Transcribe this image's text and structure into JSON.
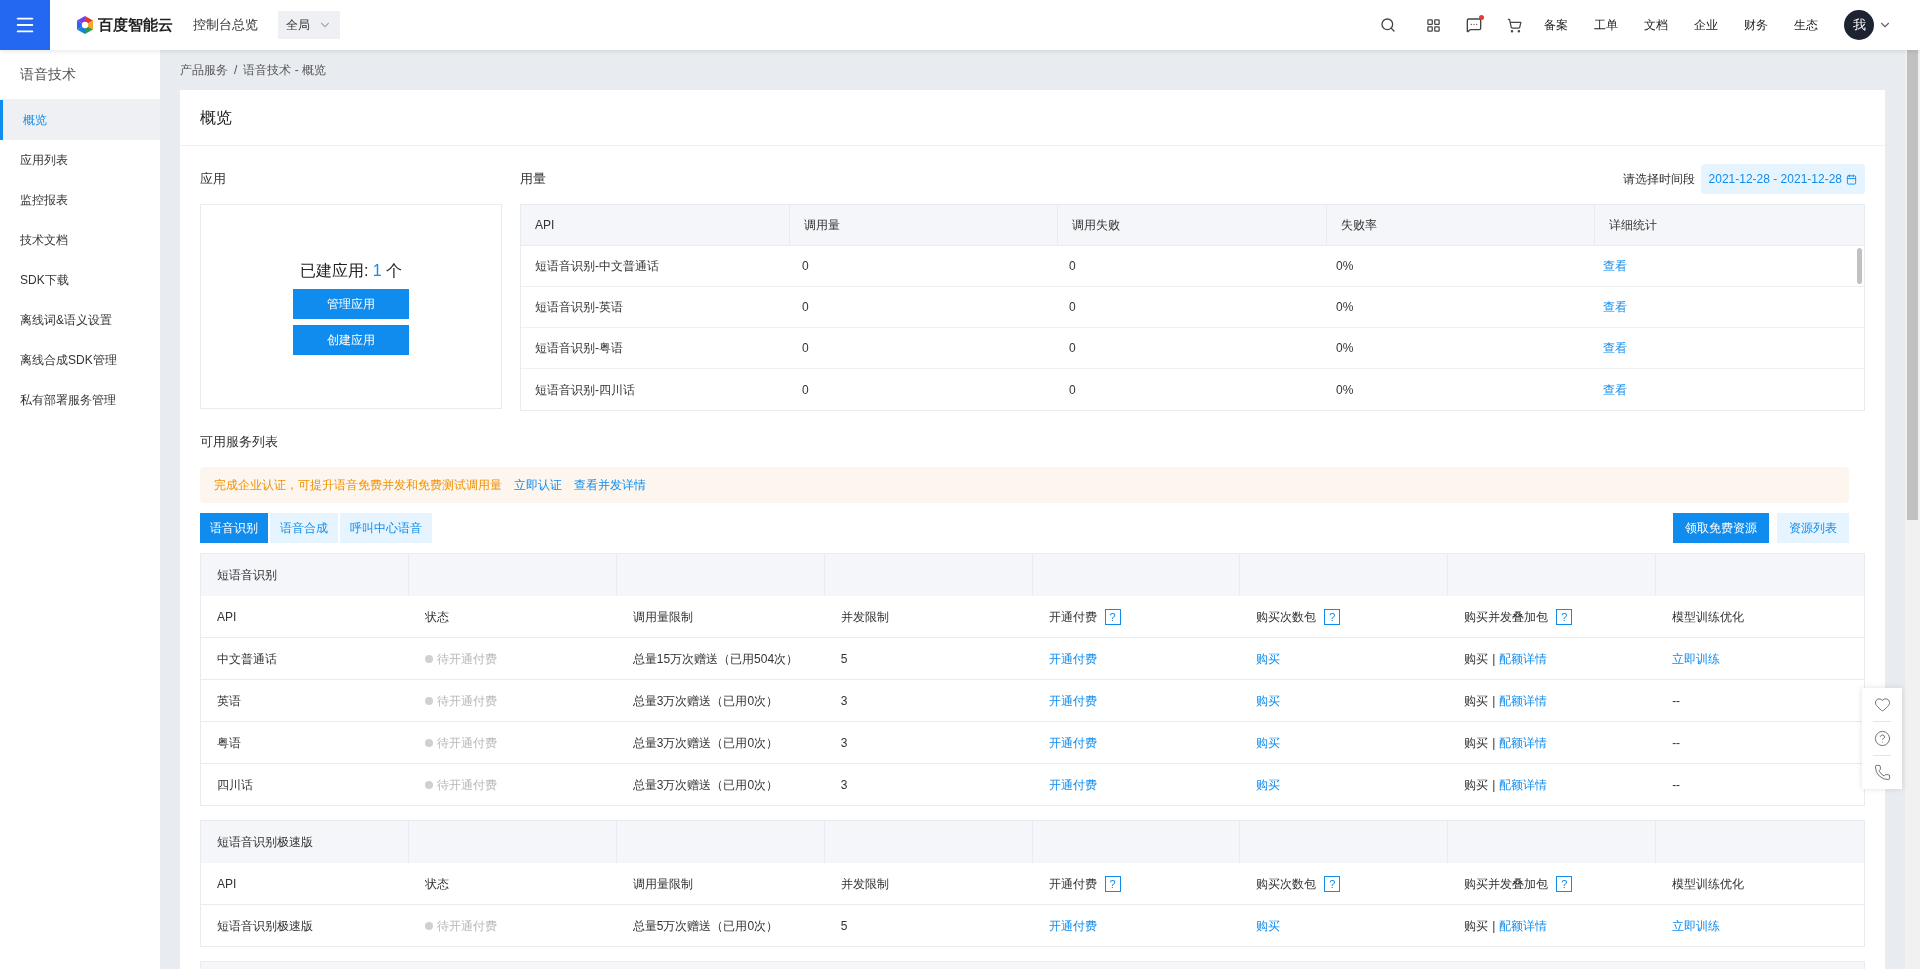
{
  "topbar": {
    "logo_text": "百度智能云",
    "console_link": "控制台总览",
    "region_select": "全局",
    "nav_links": [
      "备案",
      "工单",
      "文档",
      "企业",
      "财务",
      "生态"
    ],
    "avatar": "我",
    "has_message_dot": true
  },
  "sidebar": {
    "title": "语音技术",
    "items": [
      {
        "label": "概览",
        "selected": true
      },
      {
        "label": "应用列表",
        "selected": false
      },
      {
        "label": "监控报表",
        "selected": false
      },
      {
        "label": "技术文档",
        "selected": false
      },
      {
        "label": "SDK下载",
        "selected": false
      },
      {
        "label": "离线词&语义设置",
        "selected": false
      },
      {
        "label": "离线合成SDK管理",
        "selected": false
      },
      {
        "label": "私有部署服务管理",
        "selected": false
      }
    ]
  },
  "breadcrumb": [
    "产品服务",
    "/",
    "语音技术 - 概览"
  ],
  "page_title": "概览",
  "apps": {
    "title": "应用",
    "summary_label": "已建应用: ",
    "count": "1",
    "unit": " 个",
    "buttons": [
      "管理应用",
      "创建应用"
    ]
  },
  "usage": {
    "title": "用量",
    "date_label": "请选择时间段",
    "date_range": "2021-12-28 - 2021-12-28",
    "columns": [
      "API",
      "调用量",
      "调用失败",
      "失败率",
      "详细统计"
    ],
    "rows": [
      {
        "api": "短语音识别-中文普通话",
        "calls": "0",
        "failed": "0",
        "rate": "0%",
        "link": "查看"
      },
      {
        "api": "短语音识别-英语",
        "calls": "0",
        "failed": "0",
        "rate": "0%",
        "link": "查看"
      },
      {
        "api": "短语音识别-粤语",
        "calls": "0",
        "failed": "0",
        "rate": "0%",
        "link": "查看"
      },
      {
        "api": "短语音识别-四川话",
        "calls": "0",
        "failed": "0",
        "rate": "0%",
        "link": "查看"
      }
    ]
  },
  "services": {
    "title": "可用服务列表",
    "notice": {
      "text": "完成企业认证，可提升语音免费并发和免费测试调用量",
      "links": [
        "立即认证",
        "查看并发详情"
      ]
    },
    "tabs": [
      {
        "label": "语音识别",
        "selected": true
      },
      {
        "label": "语音合成",
        "selected": false
      },
      {
        "label": "呼叫中心语音",
        "selected": false
      }
    ],
    "actions": [
      {
        "label": "领取免费资源",
        "kind": "primary"
      },
      {
        "label": "资源列表",
        "kind": "secondary"
      }
    ],
    "groups": [
      {
        "name": "短语音识别",
        "columns": [
          {
            "label": "API"
          },
          {
            "label": "状态"
          },
          {
            "label": "调用量限制"
          },
          {
            "label": "并发限制"
          },
          {
            "label": "开通付费",
            "help": "?"
          },
          {
            "label": "购买次数包",
            "help": "?"
          },
          {
            "label": "购买并发叠加包",
            "help": "?"
          },
          {
            "label": "模型训练优化"
          }
        ],
        "rows": [
          {
            "api": "中文普通话",
            "status": "待开通付费",
            "quota": "总量15万次赠送（已用504次）",
            "concurrency": "5",
            "pay": "开通付费",
            "buy": "购买",
            "stack_buy": "购买",
            "separator": "|",
            "stack_link": "配额详情",
            "training": {
              "kind": "link",
              "text": "立即训练"
            }
          },
          {
            "api": "英语",
            "status": "待开通付费",
            "quota": "总量3万次赠送（已用0次）",
            "concurrency": "3",
            "pay": "开通付费",
            "buy": "购买",
            "stack_buy": "购买",
            "separator": "|",
            "stack_link": "配额详情",
            "training": {
              "kind": "text",
              "text": "--"
            }
          },
          {
            "api": "粤语",
            "status": "待开通付费",
            "quota": "总量3万次赠送（已用0次）",
            "concurrency": "3",
            "pay": "开通付费",
            "buy": "购买",
            "stack_buy": "购买",
            "separator": "|",
            "stack_link": "配额详情",
            "training": {
              "kind": "text",
              "text": "--"
            }
          },
          {
            "api": "四川话",
            "status": "待开通付费",
            "quota": "总量3万次赠送（已用0次）",
            "concurrency": "3",
            "pay": "开通付费",
            "buy": "购买",
            "stack_buy": "购买",
            "separator": "|",
            "stack_link": "配额详情",
            "training": {
              "kind": "text",
              "text": "--"
            }
          }
        ]
      },
      {
        "name": "短语音识别极速版",
        "columns": [
          {
            "label": "API"
          },
          {
            "label": "状态"
          },
          {
            "label": "调用量限制"
          },
          {
            "label": "并发限制"
          },
          {
            "label": "开通付费",
            "help": "?"
          },
          {
            "label": "购买次数包",
            "help": "?"
          },
          {
            "label": "购买并发叠加包",
            "help": "?"
          },
          {
            "label": "模型训练优化"
          }
        ],
        "rows": [
          {
            "api": "短语音识别极速版",
            "status": "待开通付费",
            "quota": "总量5万次赠送（已用0次）",
            "concurrency": "5",
            "pay": "开通付费",
            "buy": "购买",
            "stack_buy": "购买",
            "separator": "|",
            "stack_link": "配额详情",
            "training": {
              "kind": "link",
              "text": "立即训练"
            }
          }
        ]
      }
    ]
  }
}
